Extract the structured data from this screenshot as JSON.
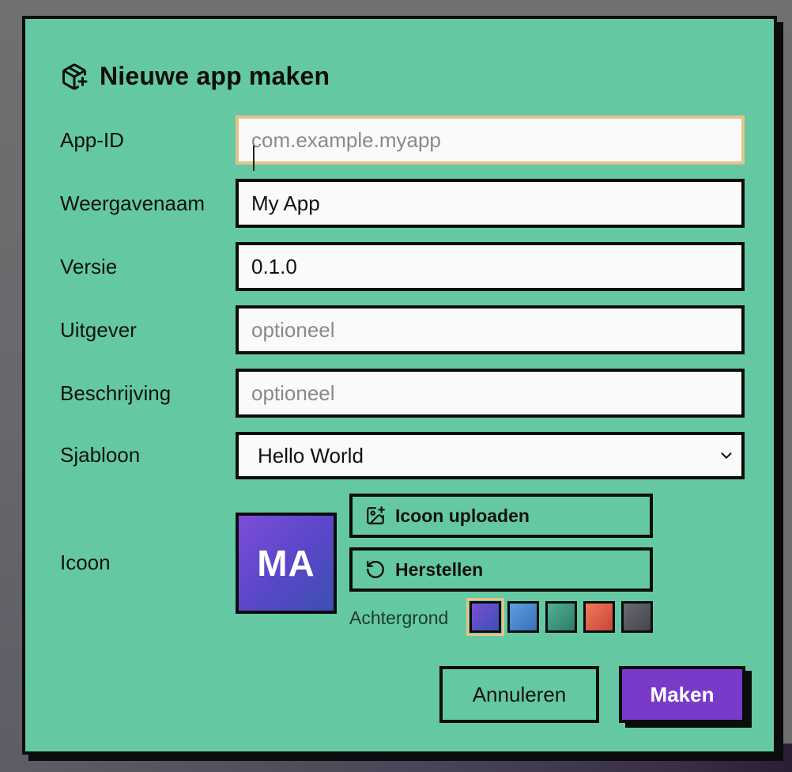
{
  "dialog": {
    "title": "Nieuwe app maken",
    "title_icon": "package-plus-icon"
  },
  "fields": {
    "app_id": {
      "label": "App-ID",
      "value": "",
      "placeholder": "com.example.myapp"
    },
    "display_name": {
      "label": "Weergavenaam",
      "value": "My App",
      "placeholder": ""
    },
    "version": {
      "label": "Versie",
      "value": "0.1.0",
      "placeholder": ""
    },
    "publisher": {
      "label": "Uitgever",
      "value": "",
      "placeholder": "optioneel"
    },
    "description": {
      "label": "Beschrijving",
      "value": "",
      "placeholder": "optioneel"
    },
    "template": {
      "label": "Sjabloon",
      "value": "Hello World"
    }
  },
  "icon": {
    "label": "Icoon",
    "initials": "MA",
    "upload_label": "Icoon uploaden",
    "reset_label": "Herstellen",
    "background_label": "Achtergrond",
    "swatches": [
      {
        "from": "#7b4fd6",
        "to": "#3c4fb3",
        "selected": true
      },
      {
        "from": "#4a90e2",
        "to": "#3a6fb0",
        "selected": false
      },
      {
        "from": "#3fa386",
        "to": "#2f7a68",
        "selected": false
      },
      {
        "from": "#e56b4e",
        "to": "#c9443c",
        "selected": false
      },
      {
        "from": "#5e5e66",
        "to": "#44444c",
        "selected": false
      }
    ]
  },
  "actions": {
    "cancel_label": "Annuleren",
    "create_label": "Maken"
  },
  "colors": {
    "dialog_bg": "#64c9a2",
    "primary": "#7a3ac9",
    "focus_border": "#e6c28a"
  }
}
